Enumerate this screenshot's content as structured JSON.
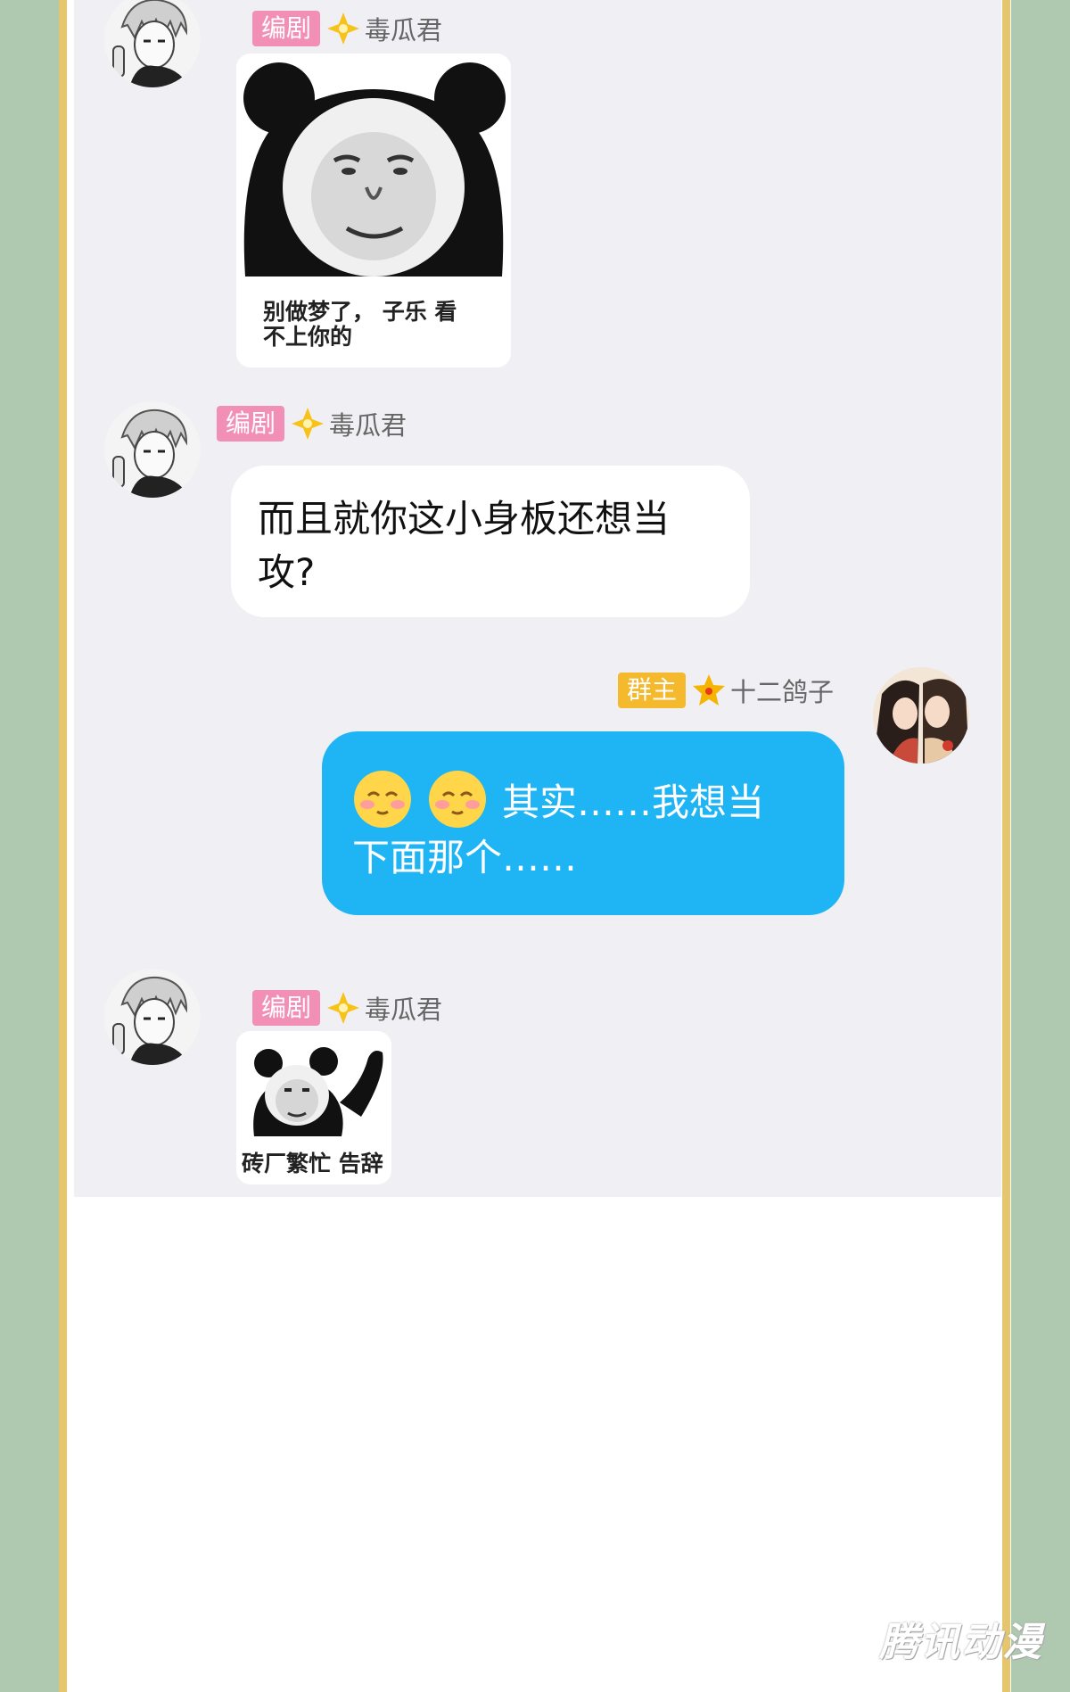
{
  "colors": {
    "background_green": "#afc9b0",
    "frame_gold": "#e6c66c",
    "chat_bg": "#f0f0f4",
    "role_pink": "#f28fb6",
    "role_gold": "#f5b92e",
    "bubble_blue": "#1fb5f5"
  },
  "messages": [
    {
      "sender": {
        "role": "编剧",
        "name": "毒瓜君",
        "avatar": "manga-boy-avatar",
        "badge_icon": "diamond-star-icon"
      },
      "type": "sticker",
      "sticker": {
        "icon": "panda-face-sticker",
        "caption_line1": "别做梦了， 子乐 看",
        "caption_line2": "不上你的"
      }
    },
    {
      "sender": {
        "role": "编剧",
        "name": "毒瓜君",
        "avatar": "manga-boy-avatar",
        "badge_icon": "diamond-star-icon"
      },
      "type": "text",
      "text_line1": "而且就你这小身板还想当",
      "text_line2": "攻?"
    },
    {
      "sender": {
        "role": "群主",
        "name": "十二鸽子",
        "avatar": "couple-illustration-avatar",
        "badge_icon": "star-icon"
      },
      "type": "text",
      "emojis": [
        "blush-emoji",
        "blush-emoji"
      ],
      "text_line1": "其实……我想当",
      "text_line2": "下面那个……"
    },
    {
      "sender": {
        "role": "编剧",
        "name": "毒瓜君",
        "avatar": "manga-boy-avatar",
        "badge_icon": "diamond-star-icon"
      },
      "type": "sticker",
      "sticker": {
        "icon": "panda-waving-sticker",
        "caption_line1": "砖厂繁忙 告辞"
      }
    }
  ],
  "watermark": "腾讯动漫"
}
